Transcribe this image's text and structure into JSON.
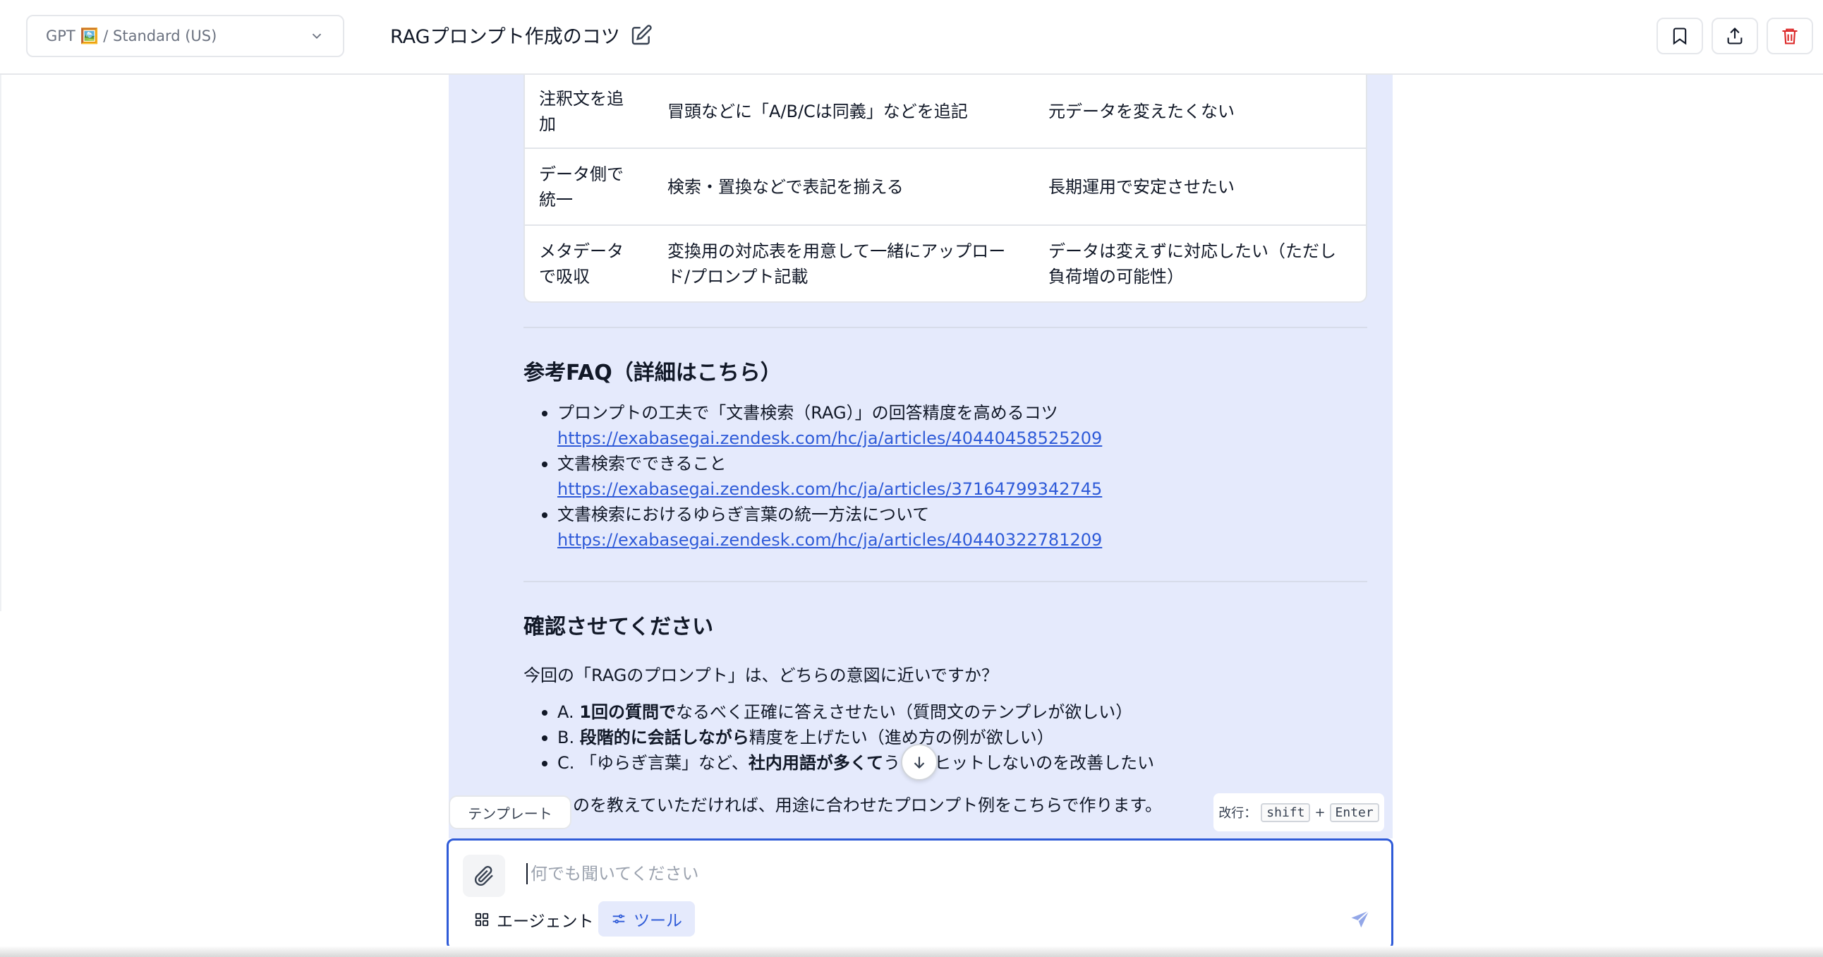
{
  "header": {
    "model_label": "GPT 🖼️ / Standard (US)",
    "title": "RAGプロンプト作成のコツ"
  },
  "table": {
    "rows": [
      [
        "注釈文を追加",
        "冒頭などに「A/B/Cは同義」などを追記",
        "元データを変えたくない"
      ],
      [
        "データ側で統一",
        "検索・置換などで表記を揃える",
        "長期運用で安定させたい"
      ],
      [
        "メタデータで吸収",
        "変換用の対応表を用意して一緒にアップロード/プロンプト記載",
        "データは変えずに対応したい（ただし負荷増の可能性）"
      ]
    ]
  },
  "faq": {
    "heading": "参考FAQ（詳細はこちら）",
    "items": [
      {
        "text": "プロンプトの工夫で「文書検索（RAG）」の回答精度を高めるコツ",
        "url": "https://exabasegai.zendesk.com/hc/ja/articles/40440458525209"
      },
      {
        "text": "文書検索でできること",
        "url": "https://exabasegai.zendesk.com/hc/ja/articles/37164799342745"
      },
      {
        "text": "文書検索におけるゆらぎ言葉の統一方法について",
        "url": "https://exabasegai.zendesk.com/hc/ja/articles/40440322781209"
      }
    ]
  },
  "confirm": {
    "heading": "確認させてください",
    "question": "今回の「RAGのプロンプト」は、どちらの意図に近いですか？",
    "options": [
      {
        "prefix": "A. ",
        "bold": "1回の質問で",
        "rest": "なるべく正確に答えさせたい（質問文のテンプレが欲しい）"
      },
      {
        "prefix": "B. ",
        "bold": "段階的に会話しながら",
        "rest": "精度を上げたい（進め方の例が欲しい）"
      },
      {
        "prefix": "C. 「ゆらぎ言葉」など、",
        "bold": "社内用語が多くて",
        "rest": "うまくヒットしないのを改善したい"
      }
    ],
    "closing_visible": "のを教えていただければ、用途に合わせたプロンプト例をこちらで作ります。"
  },
  "composer": {
    "template_label": "テンプレート",
    "newline_hint_label": "改行：",
    "key_shift": "shift",
    "key_plus": "+",
    "key_enter": "Enter",
    "placeholder": "何でも聞いてください",
    "agent_label": "エージェント",
    "tool_label": "ツール"
  },
  "colors": {
    "accent": "#2f5bd8",
    "message_bg": "#e5eafc",
    "delete_red": "#dc2626"
  }
}
